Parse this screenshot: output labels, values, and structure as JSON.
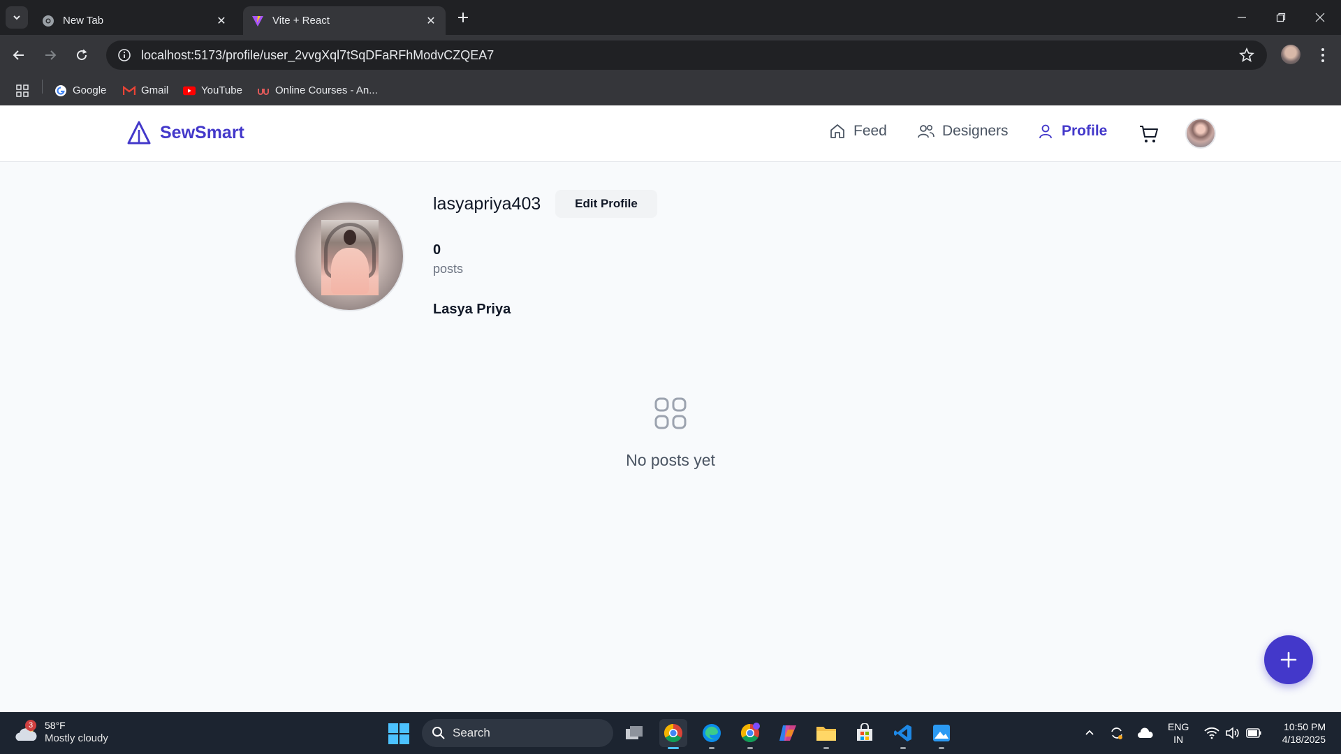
{
  "browser": {
    "tabs": [
      {
        "title": "New Tab",
        "active": false
      },
      {
        "title": "Vite + React",
        "active": true
      }
    ],
    "url": "localhost:5173/profile/user_2vvgXql7tSqDFaRFhModvCZQEA7",
    "bookmarks": [
      {
        "label": "Google",
        "icon": "google-icon"
      },
      {
        "label": "Gmail",
        "icon": "gmail-icon"
      },
      {
        "label": "YouTube",
        "icon": "youtube-icon"
      },
      {
        "label": "Online Courses - An...",
        "icon": "udemy-icon"
      }
    ]
  },
  "app": {
    "brand": "SewSmart",
    "accent_color": "#4338ca",
    "nav": [
      {
        "label": "Feed",
        "icon": "home-icon",
        "active": false
      },
      {
        "label": "Designers",
        "icon": "users-icon",
        "active": false
      },
      {
        "label": "Profile",
        "icon": "user-icon",
        "active": true
      }
    ]
  },
  "profile": {
    "username": "lasyapriya403",
    "edit_label": "Edit Profile",
    "post_count": "0",
    "post_label": "posts",
    "full_name": "Lasya Priya",
    "empty_message": "No posts yet"
  },
  "taskbar": {
    "weather": {
      "badge": "3",
      "temp": "58°F",
      "condition": "Mostly cloudy"
    },
    "search_placeholder": "Search",
    "lang_line1": "ENG",
    "lang_line2": "IN",
    "time": "10:50 PM",
    "date": "4/18/2025"
  }
}
